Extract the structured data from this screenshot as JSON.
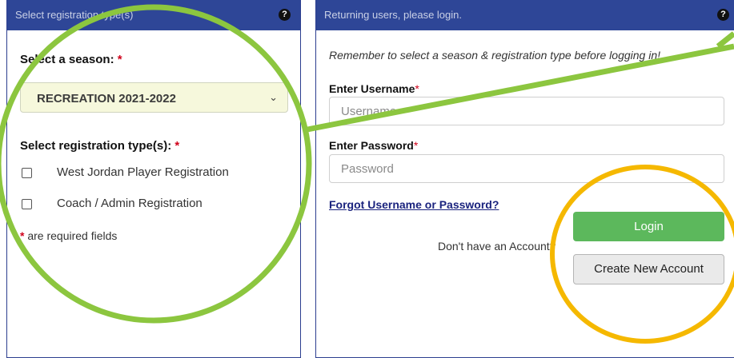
{
  "left_panel": {
    "header": "Select registration type(s)",
    "help_glyph": "?",
    "season_label": "Select a season:",
    "required_mark": "*",
    "season_selected": "RECREATION 2021-2022",
    "chevron_glyph": "⌄",
    "types_label": "Select registration type(s):",
    "options": [
      {
        "label": "West Jordan Player Registration",
        "checked": false
      },
      {
        "label": "Coach / Admin Registration",
        "checked": false
      }
    ],
    "required_note": "are required fields"
  },
  "right_panel": {
    "header": "Returning users, please login.",
    "help_glyph": "?",
    "reminder": "Remember to select a season & registration type before logging in!",
    "username_label": "Enter Username",
    "username_placeholder": "Username",
    "password_label": "Enter Password",
    "password_placeholder": "Password",
    "required_mark": "*",
    "forgot_link": "Forgot Username or Password?",
    "no_account_text": "Don't have an Account?",
    "login_button": "Login",
    "create_button": "Create New Account"
  },
  "colors": {
    "header_bg": "#2e4697",
    "login_green": "#5cb85c",
    "annotation_green": "#8cc63f",
    "annotation_yellow": "#f5b800",
    "required_red": "#d0021b"
  }
}
